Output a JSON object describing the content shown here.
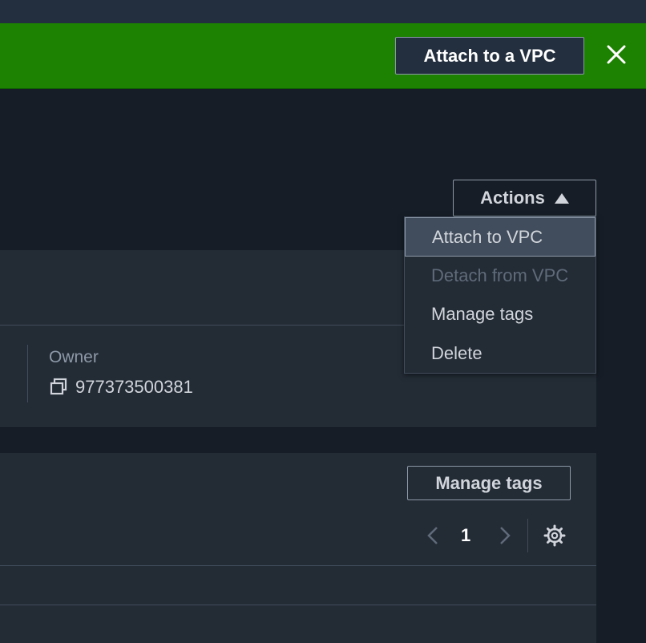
{
  "flash": {
    "action_label": "Attach to a VPC",
    "icon": "close-icon",
    "color": "#1d8102"
  },
  "header": {
    "actions_label": "Actions"
  },
  "actions_menu": {
    "items": [
      {
        "label": "Attach to VPC",
        "state": "highlighted"
      },
      {
        "label": "Detach from VPC",
        "state": "disabled"
      },
      {
        "label": "Manage tags",
        "state": "enabled"
      },
      {
        "label": "Delete",
        "state": "enabled"
      }
    ]
  },
  "details": {
    "owner_label": "Owner",
    "owner_value": "977373500381"
  },
  "tags": {
    "manage_label": "Manage tags",
    "current_page": "1"
  }
}
